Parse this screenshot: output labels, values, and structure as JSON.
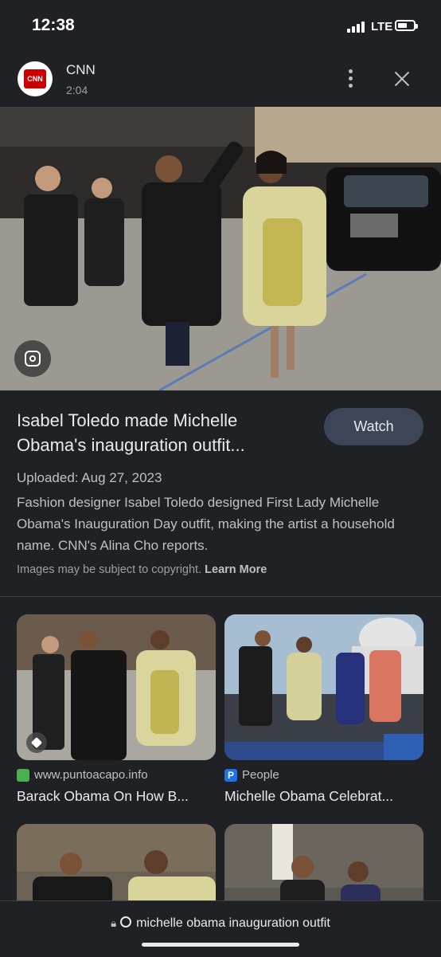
{
  "status_bar": {
    "time": "12:38",
    "network": "LTE"
  },
  "source": {
    "name": "CNN",
    "logo_text": "CNN",
    "duration": "2:04"
  },
  "hero": {
    "image_alt_icon": "google-lens-icon"
  },
  "video": {
    "title": "Isabel Toledo made Michelle Obama's inauguration outfit...",
    "watch_label": "Watch",
    "uploaded": "Uploaded: Aug 27, 2023",
    "description": "Fashion designer Isabel Toledo designed First Lady Michelle Obama's Inauguration Day outfit, making the artist a household name. CNN's Alina Cho reports.",
    "copyright": "Images may be subject to copyright.",
    "learn_more": "Learn More"
  },
  "results": [
    {
      "site": "www.puntoacapo.info",
      "title": "Barack Obama On How B...",
      "favicon_color": "#4caf50"
    },
    {
      "site": "People",
      "title": "Michelle Obama Celebrat...",
      "favicon_color": "#1a73e8"
    }
  ],
  "search_bar": {
    "query": "michelle obama inauguration outfit"
  },
  "colors": {
    "background": "#202124",
    "watch_button": "#3c4656",
    "cnn_red": "#cc0000"
  }
}
